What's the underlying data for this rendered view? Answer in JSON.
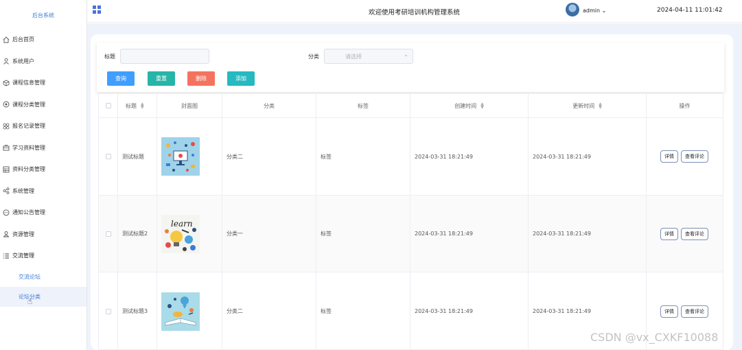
{
  "brand": "后台系统",
  "header": {
    "title": "欢迎使用考研培训机构管理系统",
    "user": "admin",
    "datetime": "2024-04-11 11:01:42"
  },
  "menu": [
    {
      "label": "后台首页",
      "icon": "home-icon"
    },
    {
      "label": "系统用户",
      "icon": "user-icon"
    },
    {
      "label": "课程信息管理",
      "icon": "cube-icon"
    },
    {
      "label": "课程分类管理",
      "icon": "target-icon"
    },
    {
      "label": "报名记录管理",
      "icon": "grid-icon"
    },
    {
      "label": "学习资料管理",
      "icon": "briefcase-icon"
    },
    {
      "label": "资料分类管理",
      "icon": "table-icon"
    },
    {
      "label": "系统管理",
      "icon": "share-icon"
    },
    {
      "label": "通知公告管理",
      "icon": "chat-icon"
    },
    {
      "label": "资源管理",
      "icon": "person-icon"
    },
    {
      "label": "交流管理",
      "icon": "list-icon"
    }
  ],
  "submenu": [
    {
      "label": "交流论坛"
    },
    {
      "label": "论坛分类"
    }
  ],
  "search": {
    "title_label": "标题",
    "category_label": "分类",
    "category_placeholder": "请选择",
    "query_btn": "查询",
    "reset_btn": "重置",
    "delete_btn": "删除",
    "add_btn": "添加"
  },
  "colors": {
    "query": "#409eff",
    "reset": "#26b5a8",
    "delete": "#f5735e",
    "add": "#26b9c0"
  },
  "table": {
    "columns": [
      "标题",
      "封面图",
      "分类",
      "标签",
      "创建时间",
      "更新时间",
      "操作"
    ],
    "rows": [
      {
        "title": "测试标题",
        "category": "分类二",
        "tag": "标签",
        "created": "2024-03-31 18:21:49",
        "updated": "2024-03-31 18:21:49",
        "detail": "详情",
        "comments": "查看评论"
      },
      {
        "title": "测试标题2",
        "category": "分类一",
        "tag": "标签",
        "created": "2024-03-31 18:21:49",
        "updated": "2024-03-31 18:21:49",
        "detail": "详情",
        "comments": "查看评论"
      },
      {
        "title": "测试标题3",
        "category": "分类二",
        "tag": "标签",
        "created": "2024-03-31 18:21:49",
        "updated": "2024-03-31 18:21:49",
        "detail": "详情",
        "comments": "查看评论"
      }
    ]
  },
  "watermark": "CSDN @vx_CXKF10088"
}
